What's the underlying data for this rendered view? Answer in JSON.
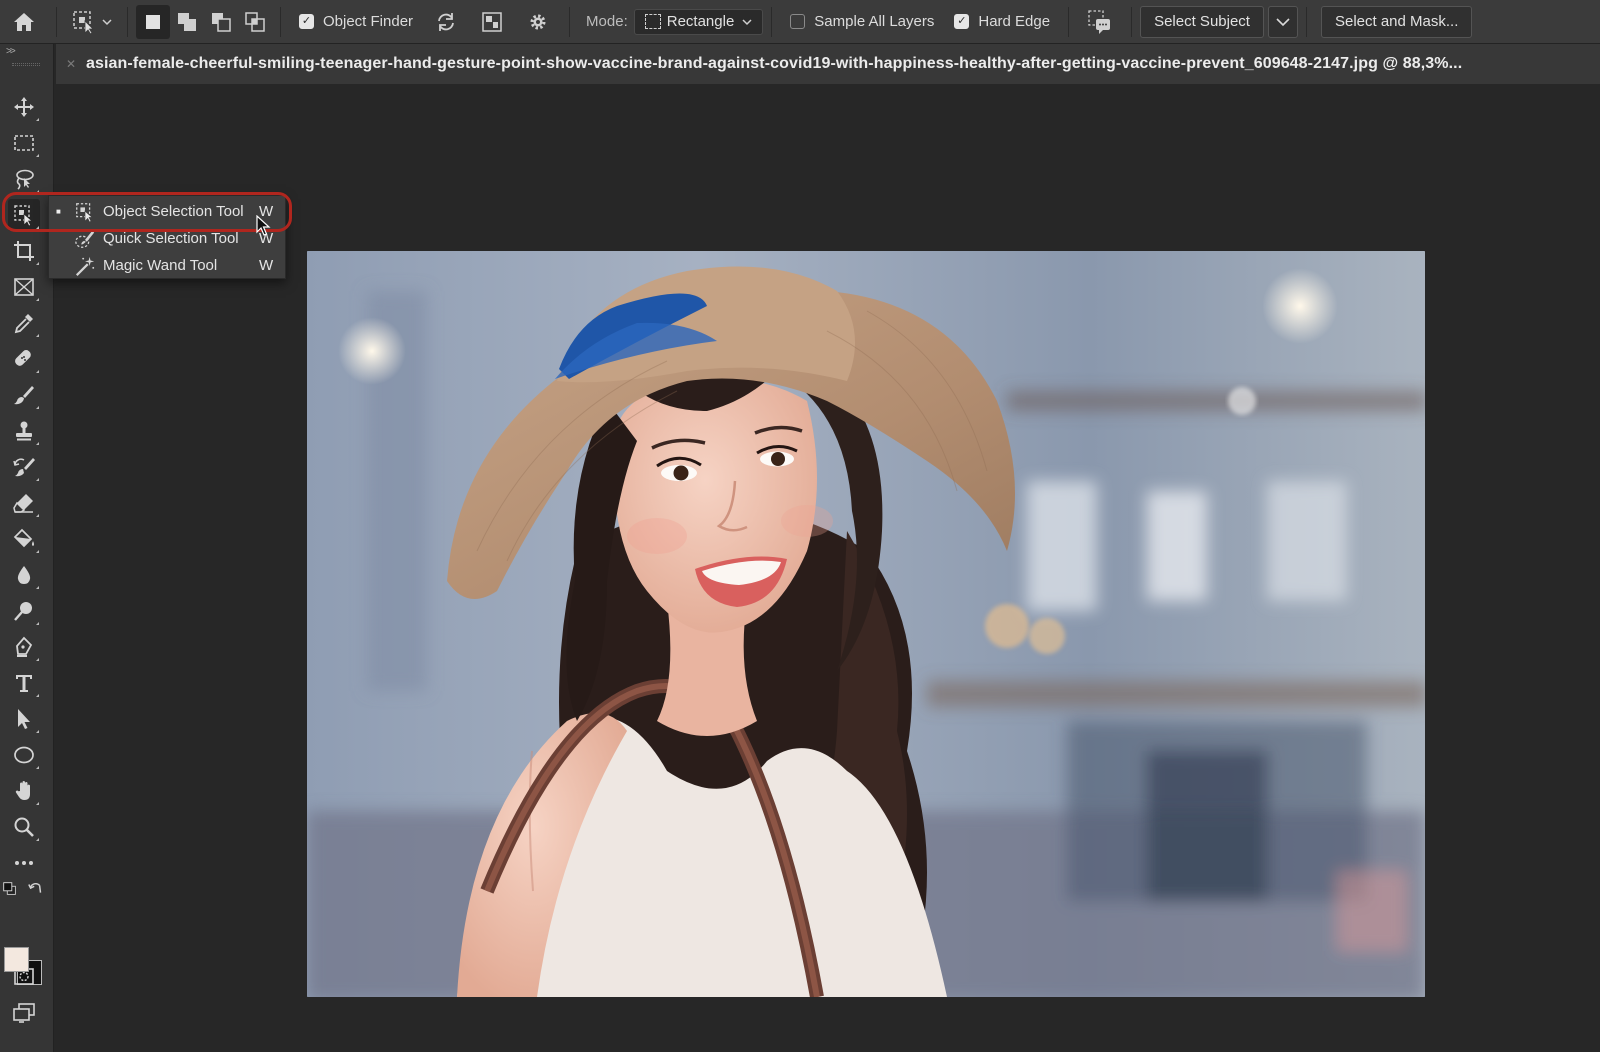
{
  "options_bar": {
    "home_icon": "home-icon",
    "object_finder_label": "Object Finder",
    "object_finder_checked": true,
    "mode_label": "Mode:",
    "mode_value": "Rectangle",
    "sample_all_layers_label": "Sample All Layers",
    "sample_all_layers_checked": false,
    "hard_edge_label": "Hard Edge",
    "hard_edge_checked": true,
    "select_subject_label": "Select Subject",
    "select_and_mask_label": "Select and Mask..."
  },
  "document": {
    "tab_title": "asian-female-cheerful-smiling-teenager-hand-gesture-point-show-vaccine-brand-against-covid19-with-happiness-healthy-after-getting-vaccine-prevent_609648-2147.jpg @ 88,3%..."
  },
  "toolbar": {
    "tools": [
      "move-tool",
      "rectangular-marquee-tool",
      "lasso-tool",
      "object-selection-tool",
      "crop-tool",
      "frame-tool",
      "eyedropper-tool",
      "spot-healing-tool",
      "brush-tool",
      "clone-stamp-tool",
      "history-brush-tool",
      "eraser-tool",
      "paint-bucket-tool",
      "blur-tool",
      "dodge-tool",
      "pen-tool",
      "type-tool",
      "path-selection-tool",
      "ellipse-tool",
      "hand-tool",
      "zoom-tool",
      "more-tools"
    ],
    "foreground_color": "#f3e8df",
    "background_color": "#111111"
  },
  "flyout": {
    "items": [
      {
        "label": "Object Selection Tool",
        "shortcut": "W",
        "active": true
      },
      {
        "label": "Quick Selection Tool",
        "shortcut": "W",
        "active": false
      },
      {
        "label": "Magic Wand Tool",
        "shortcut": "W",
        "active": false
      }
    ]
  },
  "colors": {
    "highlight_ring": "#b0261e",
    "panel_bg": "#353535",
    "workspace_bg": "#272727"
  }
}
